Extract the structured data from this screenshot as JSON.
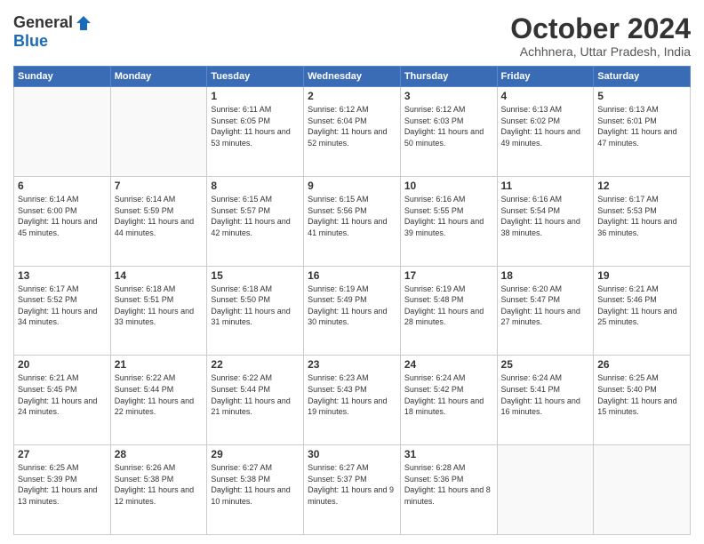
{
  "logo": {
    "general": "General",
    "blue": "Blue"
  },
  "title": "October 2024",
  "location": "Achhnera, Uttar Pradesh, India",
  "weekdays": [
    "Sunday",
    "Monday",
    "Tuesday",
    "Wednesday",
    "Thursday",
    "Friday",
    "Saturday"
  ],
  "days": [
    {
      "date": 1,
      "col": 2,
      "sunrise": "6:11 AM",
      "sunset": "6:05 PM",
      "daylight": "11 hours and 53 minutes."
    },
    {
      "date": 2,
      "col": 3,
      "sunrise": "6:12 AM",
      "sunset": "6:04 PM",
      "daylight": "11 hours and 52 minutes."
    },
    {
      "date": 3,
      "col": 4,
      "sunrise": "6:12 AM",
      "sunset": "6:03 PM",
      "daylight": "11 hours and 50 minutes."
    },
    {
      "date": 4,
      "col": 5,
      "sunrise": "6:13 AM",
      "sunset": "6:02 PM",
      "daylight": "11 hours and 49 minutes."
    },
    {
      "date": 5,
      "col": 6,
      "sunrise": "6:13 AM",
      "sunset": "6:01 PM",
      "daylight": "11 hours and 47 minutes."
    },
    {
      "date": 6,
      "col": 0,
      "sunrise": "6:14 AM",
      "sunset": "6:00 PM",
      "daylight": "11 hours and 45 minutes."
    },
    {
      "date": 7,
      "col": 1,
      "sunrise": "6:14 AM",
      "sunset": "5:59 PM",
      "daylight": "11 hours and 44 minutes."
    },
    {
      "date": 8,
      "col": 2,
      "sunrise": "6:15 AM",
      "sunset": "5:57 PM",
      "daylight": "11 hours and 42 minutes."
    },
    {
      "date": 9,
      "col": 3,
      "sunrise": "6:15 AM",
      "sunset": "5:56 PM",
      "daylight": "11 hours and 41 minutes."
    },
    {
      "date": 10,
      "col": 4,
      "sunrise": "6:16 AM",
      "sunset": "5:55 PM",
      "daylight": "11 hours and 39 minutes."
    },
    {
      "date": 11,
      "col": 5,
      "sunrise": "6:16 AM",
      "sunset": "5:54 PM",
      "daylight": "11 hours and 38 minutes."
    },
    {
      "date": 12,
      "col": 6,
      "sunrise": "6:17 AM",
      "sunset": "5:53 PM",
      "daylight": "11 hours and 36 minutes."
    },
    {
      "date": 13,
      "col": 0,
      "sunrise": "6:17 AM",
      "sunset": "5:52 PM",
      "daylight": "11 hours and 34 minutes."
    },
    {
      "date": 14,
      "col": 1,
      "sunrise": "6:18 AM",
      "sunset": "5:51 PM",
      "daylight": "11 hours and 33 minutes."
    },
    {
      "date": 15,
      "col": 2,
      "sunrise": "6:18 AM",
      "sunset": "5:50 PM",
      "daylight": "11 hours and 31 minutes."
    },
    {
      "date": 16,
      "col": 3,
      "sunrise": "6:19 AM",
      "sunset": "5:49 PM",
      "daylight": "11 hours and 30 minutes."
    },
    {
      "date": 17,
      "col": 4,
      "sunrise": "6:19 AM",
      "sunset": "5:48 PM",
      "daylight": "11 hours and 28 minutes."
    },
    {
      "date": 18,
      "col": 5,
      "sunrise": "6:20 AM",
      "sunset": "5:47 PM",
      "daylight": "11 hours and 27 minutes."
    },
    {
      "date": 19,
      "col": 6,
      "sunrise": "6:21 AM",
      "sunset": "5:46 PM",
      "daylight": "11 hours and 25 minutes."
    },
    {
      "date": 20,
      "col": 0,
      "sunrise": "6:21 AM",
      "sunset": "5:45 PM",
      "daylight": "11 hours and 24 minutes."
    },
    {
      "date": 21,
      "col": 1,
      "sunrise": "6:22 AM",
      "sunset": "5:44 PM",
      "daylight": "11 hours and 22 minutes."
    },
    {
      "date": 22,
      "col": 2,
      "sunrise": "6:22 AM",
      "sunset": "5:44 PM",
      "daylight": "11 hours and 21 minutes."
    },
    {
      "date": 23,
      "col": 3,
      "sunrise": "6:23 AM",
      "sunset": "5:43 PM",
      "daylight": "11 hours and 19 minutes."
    },
    {
      "date": 24,
      "col": 4,
      "sunrise": "6:24 AM",
      "sunset": "5:42 PM",
      "daylight": "11 hours and 18 minutes."
    },
    {
      "date": 25,
      "col": 5,
      "sunrise": "6:24 AM",
      "sunset": "5:41 PM",
      "daylight": "11 hours and 16 minutes."
    },
    {
      "date": 26,
      "col": 6,
      "sunrise": "6:25 AM",
      "sunset": "5:40 PM",
      "daylight": "11 hours and 15 minutes."
    },
    {
      "date": 27,
      "col": 0,
      "sunrise": "6:25 AM",
      "sunset": "5:39 PM",
      "daylight": "11 hours and 13 minutes."
    },
    {
      "date": 28,
      "col": 1,
      "sunrise": "6:26 AM",
      "sunset": "5:38 PM",
      "daylight": "11 hours and 12 minutes."
    },
    {
      "date": 29,
      "col": 2,
      "sunrise": "6:27 AM",
      "sunset": "5:38 PM",
      "daylight": "11 hours and 10 minutes."
    },
    {
      "date": 30,
      "col": 3,
      "sunrise": "6:27 AM",
      "sunset": "5:37 PM",
      "daylight": "11 hours and 9 minutes."
    },
    {
      "date": 31,
      "col": 4,
      "sunrise": "6:28 AM",
      "sunset": "5:36 PM",
      "daylight": "11 hours and 8 minutes."
    }
  ]
}
